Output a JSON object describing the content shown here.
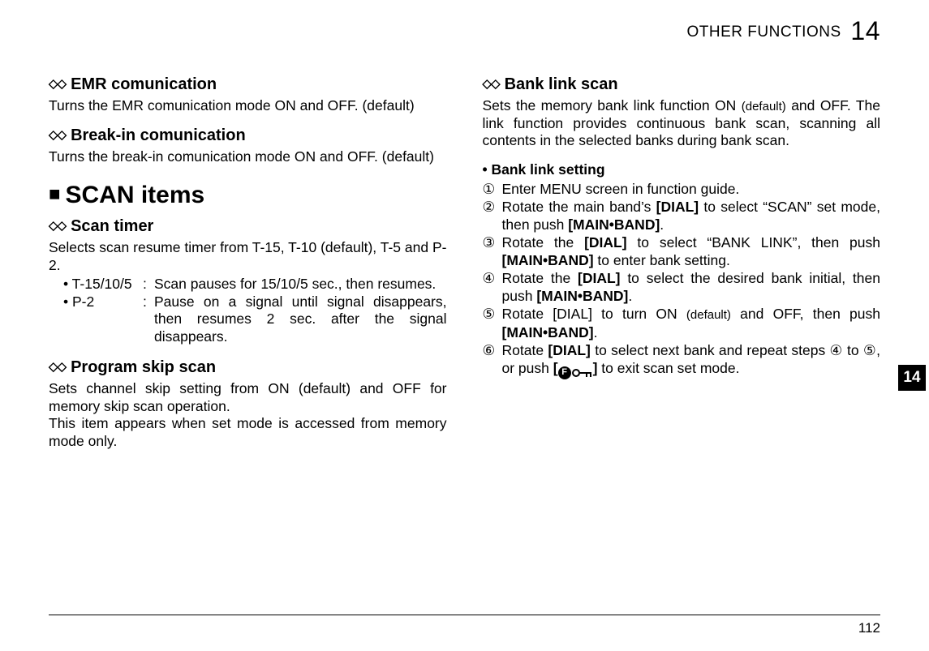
{
  "header": {
    "section": "OTHER FUNCTIONS",
    "chapter": "14"
  },
  "side_tab": "14",
  "page_number": "112",
  "left": {
    "emr": {
      "heading": "EMR comunication",
      "body": "Turns the EMR comunication mode ON and OFF. (default)"
    },
    "breakin": {
      "heading": "Break-in comunication",
      "body": "Turns the break-in comunication mode ON and OFF. (default)"
    },
    "scan_section": "SCAN items",
    "scantimer": {
      "heading": "Scan timer",
      "intro": "Selects scan resume timer from T-15, T-10 (default), T-5 and P-2.",
      "items": [
        {
          "label": "• T-15/10/5",
          "desc": "Scan pauses for 15/10/5 sec., then resumes."
        },
        {
          "label": "• P-2",
          "desc": "Pause on a signal until signal disappears, then resumes 2 sec. after the signal disappears."
        }
      ]
    },
    "progskip": {
      "heading": "Program skip scan",
      "body1": "Sets channel skip setting from ON (default) and OFF for memory skip scan operation.",
      "body2": "This item appears when set mode is accessed from memory mode only."
    }
  },
  "right": {
    "banklink": {
      "heading": "Bank link scan",
      "body_pre": "Sets the memory bank link function ON ",
      "body_default": "(default)",
      "body_post": " and OFF. The link function provides continuous bank scan, scanning all contents in the selected banks during bank scan.",
      "sub_heading": "• Bank link setting",
      "steps": {
        "s1": "Enter MENU screen in function guide.",
        "s2_a": "Rotate the main band’s ",
        "s2_b": "[DIAL]",
        "s2_c": " to select “SCAN” set mode, then push ",
        "s2_d": "[MAIN•BAND]",
        "s2_e": ".",
        "s3_a": "Rotate the ",
        "s3_b": "[DIAL]",
        "s3_c": " to select “BANK LINK”, then push ",
        "s3_d": "[MAIN•BAND]",
        "s3_e": " to enter bank setting.",
        "s4_a": "Rotate the ",
        "s4_b": "[DIAL]",
        "s4_c": " to select the desired bank initial, then push ",
        "s4_d": "[MAIN•BAND]",
        "s4_e": ".",
        "s5_a": "Rotate [DIAL] to turn ON ",
        "s5_b": "(default)",
        "s5_c": " and OFF, then push ",
        "s5_d": "[MAIN•BAND]",
        "s5_e": ".",
        "s6_a": "Rotate ",
        "s6_b": "[DIAL]",
        "s6_c": " to select next bank and repeat steps ④ to ⑤, or push ",
        "s6_d": "[",
        "s6_f": "]",
        "s6_g": " to exit scan set mode."
      }
    }
  },
  "glyphs": {
    "diamond_pair": "◇◇",
    "square": "■",
    "circ1": "①",
    "circ2": "②",
    "circ3": "③",
    "circ4": "④",
    "circ5": "⑤",
    "circ6": "⑥",
    "colon": ":"
  }
}
